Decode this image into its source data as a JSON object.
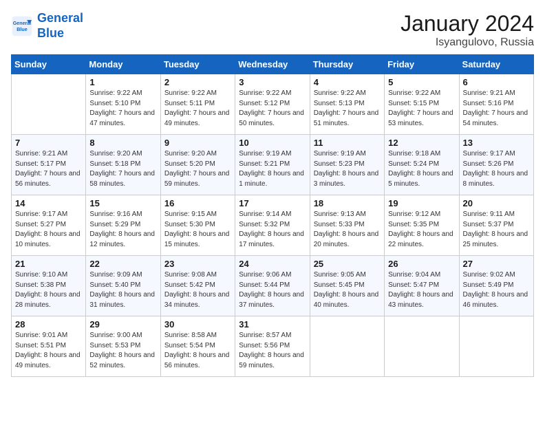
{
  "header": {
    "logo_line1": "General",
    "logo_line2": "Blue",
    "title": "January 2024",
    "subtitle": "Isyangulovo, Russia"
  },
  "columns": [
    "Sunday",
    "Monday",
    "Tuesday",
    "Wednesday",
    "Thursday",
    "Friday",
    "Saturday"
  ],
  "weeks": [
    [
      {
        "day": "",
        "sunrise": "",
        "sunset": "",
        "daylight": ""
      },
      {
        "day": "1",
        "sunrise": "Sunrise: 9:22 AM",
        "sunset": "Sunset: 5:10 PM",
        "daylight": "Daylight: 7 hours and 47 minutes."
      },
      {
        "day": "2",
        "sunrise": "Sunrise: 9:22 AM",
        "sunset": "Sunset: 5:11 PM",
        "daylight": "Daylight: 7 hours and 49 minutes."
      },
      {
        "day": "3",
        "sunrise": "Sunrise: 9:22 AM",
        "sunset": "Sunset: 5:12 PM",
        "daylight": "Daylight: 7 hours and 50 minutes."
      },
      {
        "day": "4",
        "sunrise": "Sunrise: 9:22 AM",
        "sunset": "Sunset: 5:13 PM",
        "daylight": "Daylight: 7 hours and 51 minutes."
      },
      {
        "day": "5",
        "sunrise": "Sunrise: 9:22 AM",
        "sunset": "Sunset: 5:15 PM",
        "daylight": "Daylight: 7 hours and 53 minutes."
      },
      {
        "day": "6",
        "sunrise": "Sunrise: 9:21 AM",
        "sunset": "Sunset: 5:16 PM",
        "daylight": "Daylight: 7 hours and 54 minutes."
      }
    ],
    [
      {
        "day": "7",
        "sunrise": "Sunrise: 9:21 AM",
        "sunset": "Sunset: 5:17 PM",
        "daylight": "Daylight: 7 hours and 56 minutes."
      },
      {
        "day": "8",
        "sunrise": "Sunrise: 9:20 AM",
        "sunset": "Sunset: 5:18 PM",
        "daylight": "Daylight: 7 hours and 58 minutes."
      },
      {
        "day": "9",
        "sunrise": "Sunrise: 9:20 AM",
        "sunset": "Sunset: 5:20 PM",
        "daylight": "Daylight: 7 hours and 59 minutes."
      },
      {
        "day": "10",
        "sunrise": "Sunrise: 9:19 AM",
        "sunset": "Sunset: 5:21 PM",
        "daylight": "Daylight: 8 hours and 1 minute."
      },
      {
        "day": "11",
        "sunrise": "Sunrise: 9:19 AM",
        "sunset": "Sunset: 5:23 PM",
        "daylight": "Daylight: 8 hours and 3 minutes."
      },
      {
        "day": "12",
        "sunrise": "Sunrise: 9:18 AM",
        "sunset": "Sunset: 5:24 PM",
        "daylight": "Daylight: 8 hours and 5 minutes."
      },
      {
        "day": "13",
        "sunrise": "Sunrise: 9:17 AM",
        "sunset": "Sunset: 5:26 PM",
        "daylight": "Daylight: 8 hours and 8 minutes."
      }
    ],
    [
      {
        "day": "14",
        "sunrise": "Sunrise: 9:17 AM",
        "sunset": "Sunset: 5:27 PM",
        "daylight": "Daylight: 8 hours and 10 minutes."
      },
      {
        "day": "15",
        "sunrise": "Sunrise: 9:16 AM",
        "sunset": "Sunset: 5:29 PM",
        "daylight": "Daylight: 8 hours and 12 minutes."
      },
      {
        "day": "16",
        "sunrise": "Sunrise: 9:15 AM",
        "sunset": "Sunset: 5:30 PM",
        "daylight": "Daylight: 8 hours and 15 minutes."
      },
      {
        "day": "17",
        "sunrise": "Sunrise: 9:14 AM",
        "sunset": "Sunset: 5:32 PM",
        "daylight": "Daylight: 8 hours and 17 minutes."
      },
      {
        "day": "18",
        "sunrise": "Sunrise: 9:13 AM",
        "sunset": "Sunset: 5:33 PM",
        "daylight": "Daylight: 8 hours and 20 minutes."
      },
      {
        "day": "19",
        "sunrise": "Sunrise: 9:12 AM",
        "sunset": "Sunset: 5:35 PM",
        "daylight": "Daylight: 8 hours and 22 minutes."
      },
      {
        "day": "20",
        "sunrise": "Sunrise: 9:11 AM",
        "sunset": "Sunset: 5:37 PM",
        "daylight": "Daylight: 8 hours and 25 minutes."
      }
    ],
    [
      {
        "day": "21",
        "sunrise": "Sunrise: 9:10 AM",
        "sunset": "Sunset: 5:38 PM",
        "daylight": "Daylight: 8 hours and 28 minutes."
      },
      {
        "day": "22",
        "sunrise": "Sunrise: 9:09 AM",
        "sunset": "Sunset: 5:40 PM",
        "daylight": "Daylight: 8 hours and 31 minutes."
      },
      {
        "day": "23",
        "sunrise": "Sunrise: 9:08 AM",
        "sunset": "Sunset: 5:42 PM",
        "daylight": "Daylight: 8 hours and 34 minutes."
      },
      {
        "day": "24",
        "sunrise": "Sunrise: 9:06 AM",
        "sunset": "Sunset: 5:44 PM",
        "daylight": "Daylight: 8 hours and 37 minutes."
      },
      {
        "day": "25",
        "sunrise": "Sunrise: 9:05 AM",
        "sunset": "Sunset: 5:45 PM",
        "daylight": "Daylight: 8 hours and 40 minutes."
      },
      {
        "day": "26",
        "sunrise": "Sunrise: 9:04 AM",
        "sunset": "Sunset: 5:47 PM",
        "daylight": "Daylight: 8 hours and 43 minutes."
      },
      {
        "day": "27",
        "sunrise": "Sunrise: 9:02 AM",
        "sunset": "Sunset: 5:49 PM",
        "daylight": "Daylight: 8 hours and 46 minutes."
      }
    ],
    [
      {
        "day": "28",
        "sunrise": "Sunrise: 9:01 AM",
        "sunset": "Sunset: 5:51 PM",
        "daylight": "Daylight: 8 hours and 49 minutes."
      },
      {
        "day": "29",
        "sunrise": "Sunrise: 9:00 AM",
        "sunset": "Sunset: 5:53 PM",
        "daylight": "Daylight: 8 hours and 52 minutes."
      },
      {
        "day": "30",
        "sunrise": "Sunrise: 8:58 AM",
        "sunset": "Sunset: 5:54 PM",
        "daylight": "Daylight: 8 hours and 56 minutes."
      },
      {
        "day": "31",
        "sunrise": "Sunrise: 8:57 AM",
        "sunset": "Sunset: 5:56 PM",
        "daylight": "Daylight: 8 hours and 59 minutes."
      },
      {
        "day": "",
        "sunrise": "",
        "sunset": "",
        "daylight": ""
      },
      {
        "day": "",
        "sunrise": "",
        "sunset": "",
        "daylight": ""
      },
      {
        "day": "",
        "sunrise": "",
        "sunset": "",
        "daylight": ""
      }
    ]
  ]
}
